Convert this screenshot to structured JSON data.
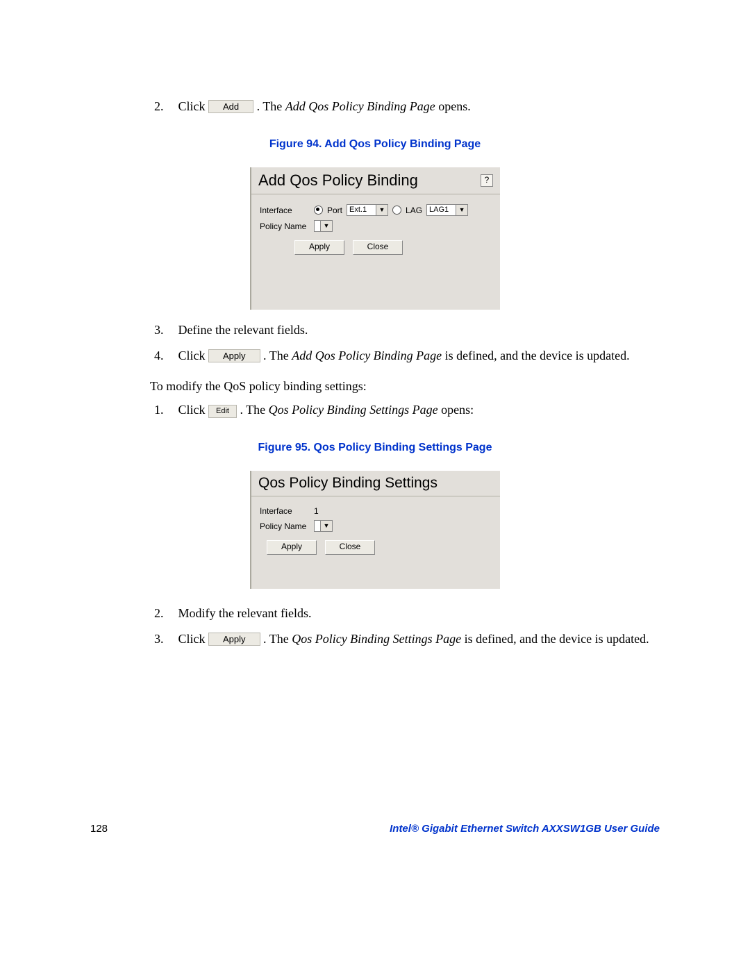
{
  "steps_a": {
    "s2": {
      "num": "2.",
      "click": "Click",
      "btn": "Add",
      "after1": ". The ",
      "italic": "Add Qos Policy Binding Page",
      "after2": " opens."
    },
    "s3": {
      "num": "3.",
      "text": "Define the relevant fields."
    },
    "s4": {
      "num": "4.",
      "click": "Click",
      "btn": "Apply",
      "after1": ". The ",
      "italic": "Add Qos Policy Binding Page",
      "after2": " is defined, and the device is updated."
    }
  },
  "intro2": "To modify the QoS policy binding settings:",
  "steps_b": {
    "s1": {
      "num": "1.",
      "click": "Click",
      "btn": "Edit",
      "after1": ". The ",
      "italic": "Qos Policy Binding Settings Page",
      "after2": " opens:"
    },
    "s2": {
      "num": "2.",
      "text": "Modify the relevant fields."
    },
    "s3": {
      "num": "3.",
      "click": "Click",
      "btn": "Apply",
      "after1": ". The ",
      "italic": "Qos Policy Binding Settings Page",
      "after2": " is defined, and the device is updated."
    }
  },
  "fig94_caption": "Figure 94. Add Qos Policy Binding Page",
  "fig95_caption": "Figure 95. Qos Policy Binding Settings Page",
  "dialog1": {
    "title": "Add Qos Policy Binding",
    "help": "?",
    "lbl_interface": "Interface",
    "lbl_port": "Port",
    "val_port": "Ext.1",
    "lbl_lag": "LAG",
    "val_lag": "LAG1",
    "lbl_policy": "Policy Name",
    "apply": "Apply",
    "close": "Close"
  },
  "dialog2": {
    "title": "Qos Policy Binding Settings",
    "lbl_interface": "Interface",
    "val_interface": "1",
    "lbl_policy": "Policy Name",
    "apply": "Apply",
    "close": "Close"
  },
  "arrow": "▼",
  "footer": {
    "page": "128",
    "guide": "Intel® Gigabit Ethernet Switch AXXSW1GB User Guide"
  }
}
